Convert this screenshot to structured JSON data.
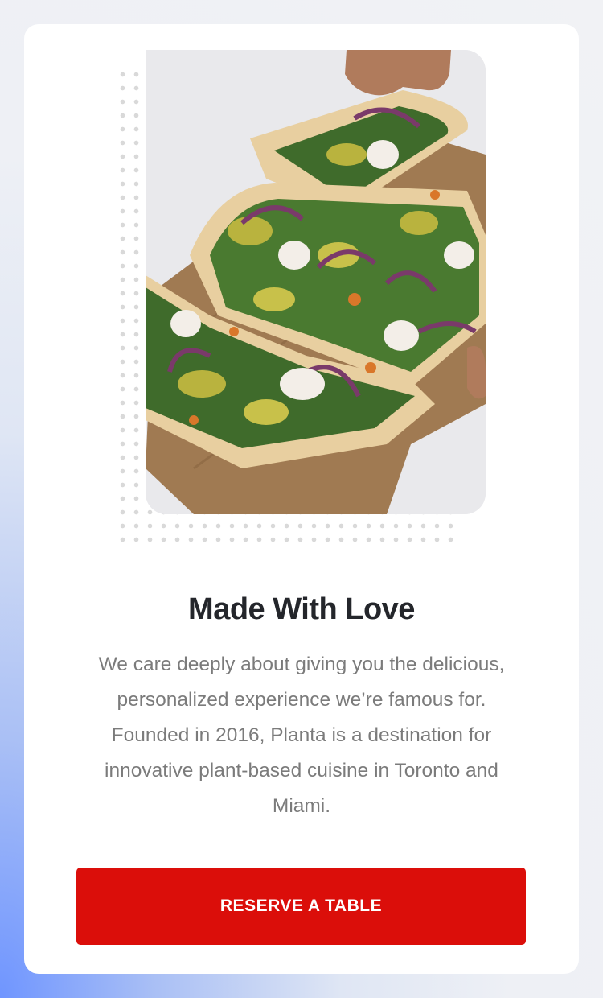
{
  "hero": {
    "image_alt": "Flatbread pizza topped with greens, red onion and cashew cream on a wooden board",
    "image_colors": {
      "background": "#e9e9ec",
      "board": "#a07a52",
      "crust": "#e8cfa0",
      "greens": "#3f6b2b",
      "zucchini": "#b9b33e",
      "onion": "#7a3a6a",
      "cream": "#f3eee8"
    }
  },
  "content": {
    "title": "Made With Love",
    "description": "We care deeply about giving you the delicious, personalized experience we’re famous for. Founded in 2016, Planta is a destination for innovative plant-based cuisine in Toronto and Miami."
  },
  "cta": {
    "label": "RESERVE A TABLE",
    "color": "#db0e0a"
  }
}
